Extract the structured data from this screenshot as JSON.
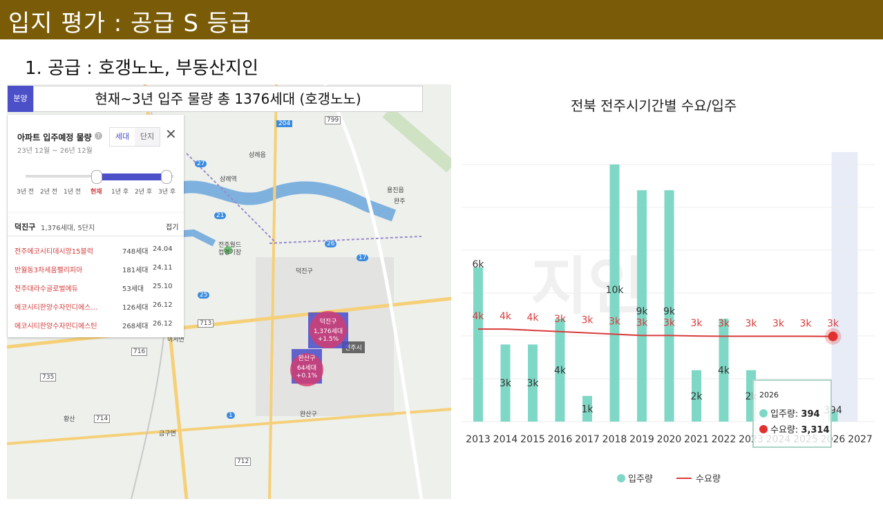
{
  "header": {
    "title": "입지 평가 : 공급 S 등급"
  },
  "section": {
    "heading": "1. 공급 : 호갱노노, 부동산지인"
  },
  "map": {
    "tag": "분양",
    "banner": "현재~3년 입주 물량 총 1376세대 (호갱노노)",
    "panel": {
      "title": "아파트 입주예정 물량",
      "date_range": "23년 12월 ~ 26년 12월",
      "toggle_households": "세대",
      "toggle_complex": "단지",
      "slider_labels": [
        "3년 전",
        "2년 전",
        "1년 전",
        "현재",
        "1년 후",
        "2년 후",
        "3년 후"
      ]
    },
    "list": {
      "district": "덕진구",
      "summary": "1,376세대, 5단지",
      "fold_label": "접기",
      "rows": [
        {
          "name": "전주에코시티데시앙15블럭",
          "units": "748세대",
          "date": "24.04"
        },
        {
          "name": "반월동3차세움펠리피아",
          "units": "181세대",
          "date": "24.11"
        },
        {
          "name": "전주대라수글로벌에듀",
          "units": "53세대",
          "date": "25.10"
        },
        {
          "name": "에코시티한양수자인디에스…",
          "units": "126세대",
          "date": "26.12"
        },
        {
          "name": "에코시티한양수자인디에스틴",
          "units": "268세대",
          "date": "26.12"
        }
      ]
    },
    "markers": [
      {
        "name": "덕진구",
        "units": "1,376세대",
        "change": "+1.5%"
      },
      {
        "name": "완산구",
        "units": "64세대",
        "change": "+0.1%"
      }
    ],
    "place_labels": [
      "삼례읍",
      "용진읍",
      "덕진구",
      "완산구",
      "전주시",
      "전주월드컵경기장",
      "삼례역",
      "금구면",
      "황산",
      "이서면",
      "완주"
    ],
    "road_labels": [
      "713",
      "716",
      "735",
      "712",
      "714",
      "799",
      "1",
      "17",
      "21",
      "25",
      "26",
      "27",
      "204"
    ]
  },
  "chart_data": {
    "type": "bar",
    "title": "전북 전주시기간별 수요/입주",
    "categories": [
      "2013",
      "2014",
      "2015",
      "2016",
      "2017",
      "2018",
      "2019",
      "2020",
      "2021",
      "2022",
      "2023",
      "2024",
      "2025",
      "2026",
      "2027"
    ],
    "series": [
      {
        "name": "입주량",
        "color": "#7fd8c6",
        "values": [
          6,
          3,
          3,
          4,
          1,
          10,
          9,
          9,
          2,
          4,
          2,
          0,
          0,
          0.394,
          0
        ],
        "labels": [
          "6k",
          "3k",
          "3k",
          "4k",
          "1k",
          "10k",
          "9k",
          "9k",
          "2k",
          "4k",
          "2k",
          "",
          "",
          "394",
          ""
        ]
      },
      {
        "name": "수요량",
        "color": "#d93a3a",
        "type": "line",
        "values": [
          3.6,
          3.6,
          3.55,
          3.5,
          3.45,
          3.4,
          3.35,
          3.35,
          3.33,
          3.32,
          3.32,
          3.32,
          3.32,
          3.314,
          null
        ],
        "labels": [
          "4k",
          "4k",
          "4k",
          "3k",
          "3k",
          "3k",
          "3k",
          "3k",
          "3k",
          "3k",
          "3k",
          "3k",
          "3k",
          "3k",
          ""
        ]
      }
    ],
    "ylim": [
      0,
      10
    ],
    "highlight": "2026",
    "tooltip": {
      "year": "2026",
      "supply_label": "입주량:",
      "supply_value": "394",
      "demand_label": "수요량:",
      "demand_value": "3,314"
    },
    "legend_position": "bottom",
    "watermark": "지인"
  }
}
